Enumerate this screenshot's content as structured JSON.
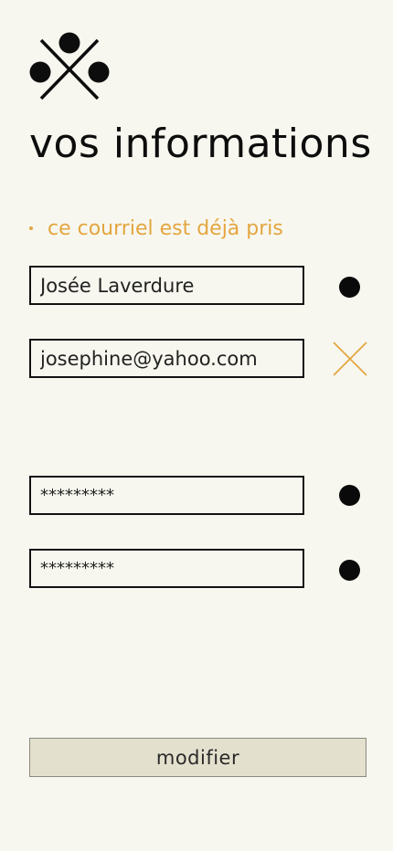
{
  "logo": {
    "icon": "logo-icon"
  },
  "page": {
    "title": "vos informations"
  },
  "error": {
    "message": "ce courriel est déjà pris",
    "color": "#e4a640"
  },
  "form": {
    "name": {
      "value": "Josée Laverdure",
      "status_icon": "valid-dot-icon"
    },
    "email": {
      "value": "josephine@yahoo.com",
      "status_icon": "error-x-icon"
    },
    "password": {
      "value": "*********",
      "status_icon": "valid-dot-icon"
    },
    "password_confirm": {
      "value": "*********",
      "status_icon": "valid-dot-icon"
    },
    "submit_label": "modifier"
  },
  "colors": {
    "background": "#f7f7ef",
    "text": "#111111",
    "accent_error": "#e4a640",
    "button_background": "#e4e0ce"
  }
}
